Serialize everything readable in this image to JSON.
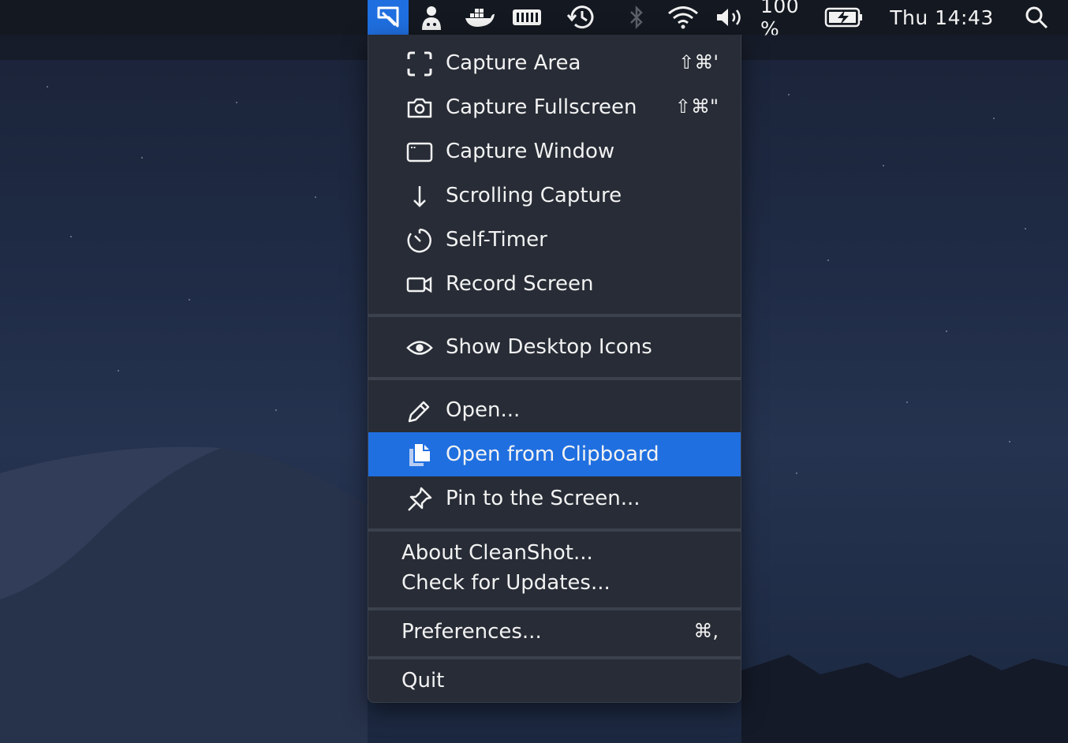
{
  "menubar": {
    "icons": [
      "cleanshot-icon",
      "bartender-icon",
      "docker-icon",
      "memory-icon",
      "time-machine-icon",
      "bluetooth-icon",
      "wifi-icon",
      "volume-icon",
      "battery-icon",
      "spotlight-icon"
    ],
    "battery_percent": "100 %",
    "clock": "Thu 14:43",
    "accent": "#1f6fe0"
  },
  "menu": {
    "capture_section": [
      {
        "label": "Capture Area",
        "shortcut": "⇧⌘'",
        "icon": "capture-area-icon"
      },
      {
        "label": "Capture Fullscreen",
        "shortcut": "⇧⌘\"",
        "icon": "camera-icon"
      },
      {
        "label": "Capture Window",
        "shortcut": "",
        "icon": "window-icon"
      },
      {
        "label": "Scrolling Capture",
        "shortcut": "",
        "icon": "arrow-down-icon"
      },
      {
        "label": "Self-Timer",
        "shortcut": "",
        "icon": "timer-icon"
      },
      {
        "label": "Record Screen",
        "shortcut": "",
        "icon": "video-icon"
      }
    ],
    "show_desktop_icons": "Show Desktop Icons",
    "open": "Open...",
    "open_from_clipboard": "Open from Clipboard",
    "pin_to_screen": "Pin to the Screen...",
    "about": "About CleanShot...",
    "check_updates": "Check for Updates...",
    "preferences": "Preferences...",
    "preferences_shortcut": "⌘,",
    "quit": "Quit"
  }
}
